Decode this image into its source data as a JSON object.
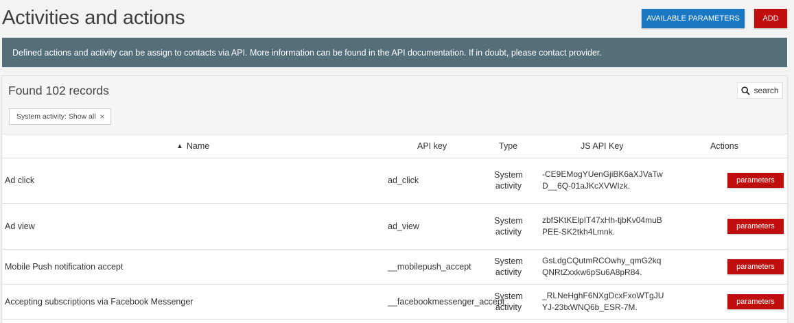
{
  "header": {
    "title": "Activities and actions",
    "available_parameters_label": "AVAILABLE PARAMETERS",
    "add_label": "ADD"
  },
  "info_banner": {
    "text": "Defined actions and activity can be assign to contacts via API. More information can be found in the API documentation. If in doubt, please contact provider."
  },
  "panel": {
    "records_text": "Found 102 records",
    "search_label": "search",
    "search_icon": "search-icon",
    "filter_chip": {
      "label": "System activity: Show all",
      "close": "×"
    }
  },
  "table": {
    "columns": {
      "sort_arrow": "▲",
      "name": "Name",
      "api_key": "API key",
      "type": "Type",
      "js_api_key": "JS API Key",
      "actions": "Actions"
    },
    "rows": [
      {
        "name": "Ad click",
        "api_key": "ad_click",
        "type": "System activity",
        "js_api_key": "-CE9EMogYUenGjiBK6aXJVaTwD__6Q-01aJKcXVWIzk.",
        "action_label": "parameters"
      },
      {
        "name": "Ad view",
        "api_key": "ad_view",
        "type": "System activity",
        "js_api_key": "zbfSKtKElpIT47xHh-tjbKv04muBPEE-SK2tkh4Lmnk.",
        "action_label": "parameters"
      },
      {
        "name": "Mobile Push notification accept",
        "api_key": "__mobilepush_accept",
        "type": "System activity",
        "js_api_key": "GsLdgCQutmRCOwhy_qmG2kqQNRtZxxkw6pSu6A8pR84.",
        "action_label": "parameters"
      },
      {
        "name": "Accepting subscriptions via Facebook Messenger",
        "api_key": "__facebookmessenger_accept",
        "type": "System activity",
        "js_api_key": "_RLNeHghF6NXgDcxFxoWTgJUYJ-23txWNQ6b_ESR-7M.",
        "action_label": "parameters"
      }
    ]
  },
  "colors": {
    "primary_blue": "#1a78c2",
    "danger_red": "#c00d0d",
    "banner": "#546e7a"
  }
}
